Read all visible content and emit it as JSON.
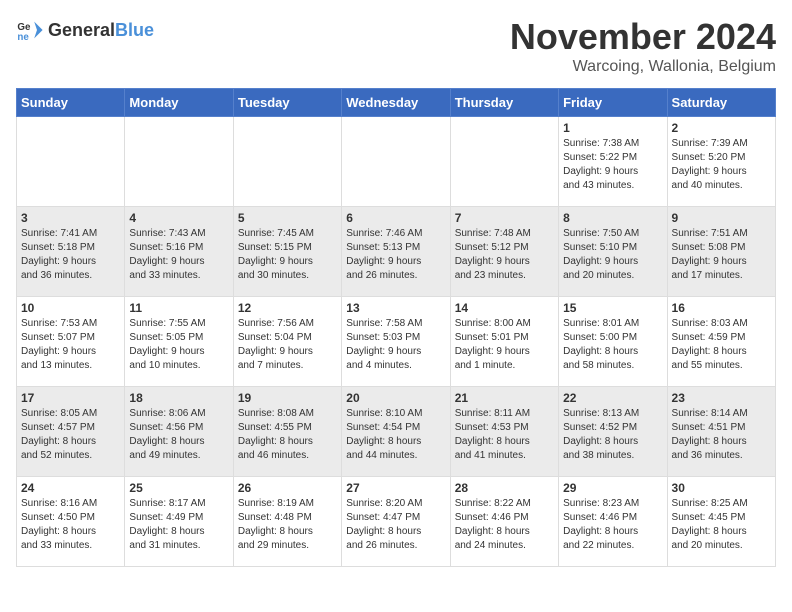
{
  "logo": {
    "general": "General",
    "blue": "Blue"
  },
  "title": "November 2024",
  "location": "Warcoing, Wallonia, Belgium",
  "days_of_week": [
    "Sunday",
    "Monday",
    "Tuesday",
    "Wednesday",
    "Thursday",
    "Friday",
    "Saturday"
  ],
  "weeks": [
    [
      {
        "day": "",
        "info": ""
      },
      {
        "day": "",
        "info": ""
      },
      {
        "day": "",
        "info": ""
      },
      {
        "day": "",
        "info": ""
      },
      {
        "day": "",
        "info": ""
      },
      {
        "day": "1",
        "info": "Sunrise: 7:38 AM\nSunset: 5:22 PM\nDaylight: 9 hours\nand 43 minutes."
      },
      {
        "day": "2",
        "info": "Sunrise: 7:39 AM\nSunset: 5:20 PM\nDaylight: 9 hours\nand 40 minutes."
      }
    ],
    [
      {
        "day": "3",
        "info": "Sunrise: 7:41 AM\nSunset: 5:18 PM\nDaylight: 9 hours\nand 36 minutes."
      },
      {
        "day": "4",
        "info": "Sunrise: 7:43 AM\nSunset: 5:16 PM\nDaylight: 9 hours\nand 33 minutes."
      },
      {
        "day": "5",
        "info": "Sunrise: 7:45 AM\nSunset: 5:15 PM\nDaylight: 9 hours\nand 30 minutes."
      },
      {
        "day": "6",
        "info": "Sunrise: 7:46 AM\nSunset: 5:13 PM\nDaylight: 9 hours\nand 26 minutes."
      },
      {
        "day": "7",
        "info": "Sunrise: 7:48 AM\nSunset: 5:12 PM\nDaylight: 9 hours\nand 23 minutes."
      },
      {
        "day": "8",
        "info": "Sunrise: 7:50 AM\nSunset: 5:10 PM\nDaylight: 9 hours\nand 20 minutes."
      },
      {
        "day": "9",
        "info": "Sunrise: 7:51 AM\nSunset: 5:08 PM\nDaylight: 9 hours\nand 17 minutes."
      }
    ],
    [
      {
        "day": "10",
        "info": "Sunrise: 7:53 AM\nSunset: 5:07 PM\nDaylight: 9 hours\nand 13 minutes."
      },
      {
        "day": "11",
        "info": "Sunrise: 7:55 AM\nSunset: 5:05 PM\nDaylight: 9 hours\nand 10 minutes."
      },
      {
        "day": "12",
        "info": "Sunrise: 7:56 AM\nSunset: 5:04 PM\nDaylight: 9 hours\nand 7 minutes."
      },
      {
        "day": "13",
        "info": "Sunrise: 7:58 AM\nSunset: 5:03 PM\nDaylight: 9 hours\nand 4 minutes."
      },
      {
        "day": "14",
        "info": "Sunrise: 8:00 AM\nSunset: 5:01 PM\nDaylight: 9 hours\nand 1 minute."
      },
      {
        "day": "15",
        "info": "Sunrise: 8:01 AM\nSunset: 5:00 PM\nDaylight: 8 hours\nand 58 minutes."
      },
      {
        "day": "16",
        "info": "Sunrise: 8:03 AM\nSunset: 4:59 PM\nDaylight: 8 hours\nand 55 minutes."
      }
    ],
    [
      {
        "day": "17",
        "info": "Sunrise: 8:05 AM\nSunset: 4:57 PM\nDaylight: 8 hours\nand 52 minutes."
      },
      {
        "day": "18",
        "info": "Sunrise: 8:06 AM\nSunset: 4:56 PM\nDaylight: 8 hours\nand 49 minutes."
      },
      {
        "day": "19",
        "info": "Sunrise: 8:08 AM\nSunset: 4:55 PM\nDaylight: 8 hours\nand 46 minutes."
      },
      {
        "day": "20",
        "info": "Sunrise: 8:10 AM\nSunset: 4:54 PM\nDaylight: 8 hours\nand 44 minutes."
      },
      {
        "day": "21",
        "info": "Sunrise: 8:11 AM\nSunset: 4:53 PM\nDaylight: 8 hours\nand 41 minutes."
      },
      {
        "day": "22",
        "info": "Sunrise: 8:13 AM\nSunset: 4:52 PM\nDaylight: 8 hours\nand 38 minutes."
      },
      {
        "day": "23",
        "info": "Sunrise: 8:14 AM\nSunset: 4:51 PM\nDaylight: 8 hours\nand 36 minutes."
      }
    ],
    [
      {
        "day": "24",
        "info": "Sunrise: 8:16 AM\nSunset: 4:50 PM\nDaylight: 8 hours\nand 33 minutes."
      },
      {
        "day": "25",
        "info": "Sunrise: 8:17 AM\nSunset: 4:49 PM\nDaylight: 8 hours\nand 31 minutes."
      },
      {
        "day": "26",
        "info": "Sunrise: 8:19 AM\nSunset: 4:48 PM\nDaylight: 8 hours\nand 29 minutes."
      },
      {
        "day": "27",
        "info": "Sunrise: 8:20 AM\nSunset: 4:47 PM\nDaylight: 8 hours\nand 26 minutes."
      },
      {
        "day": "28",
        "info": "Sunrise: 8:22 AM\nSunset: 4:46 PM\nDaylight: 8 hours\nand 24 minutes."
      },
      {
        "day": "29",
        "info": "Sunrise: 8:23 AM\nSunset: 4:46 PM\nDaylight: 8 hours\nand 22 minutes."
      },
      {
        "day": "30",
        "info": "Sunrise: 8:25 AM\nSunset: 4:45 PM\nDaylight: 8 hours\nand 20 minutes."
      }
    ]
  ]
}
